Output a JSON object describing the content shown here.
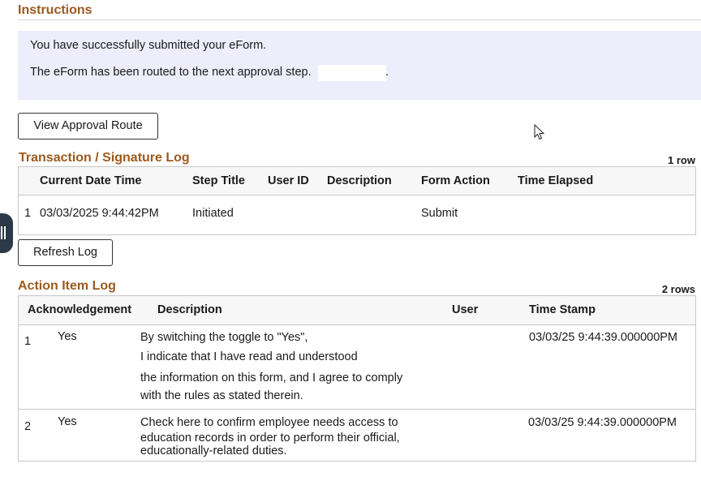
{
  "instructions": {
    "title": "Instructions",
    "line1": "You have successfully submitted your eForm.",
    "line2": "The eForm has been routed to the next approval step.",
    "line2_end": "."
  },
  "buttons": {
    "view_route": "View Approval Route",
    "refresh_log": "Refresh Log"
  },
  "transaction_log": {
    "title": "Transaction / Signature Log",
    "row_count": "1 row",
    "headers": [
      "Current Date Time",
      "Step Title",
      "User ID",
      "Description",
      "Form Action",
      "Time Elapsed"
    ],
    "rows": [
      {
        "num": "1",
        "datetime": "03/03/2025  9:44:42PM",
        "step": "Initiated",
        "user": "",
        "description": "",
        "action": "Submit",
        "elapsed": ""
      }
    ]
  },
  "action_log": {
    "title": "Action Item Log",
    "row_count": "2 rows",
    "headers": [
      "Acknowledgement",
      "Description",
      "User",
      "Time Stamp"
    ],
    "rows": [
      {
        "num": "1",
        "ack": "Yes",
        "desc": [
          "By switching the toggle to \"Yes\",",
          "I indicate that I have read and understood",
          "the information on this form, and I agree to comply",
          "with the rules as stated therein."
        ],
        "user": "",
        "timestamp": "03/03/25  9:44:39.000000PM"
      },
      {
        "num": "2",
        "ack": "Yes",
        "desc": [
          "Check here to confirm employee needs access to",
          "education records in order to perform their official,",
          "educationally-related duties."
        ],
        "user": "",
        "timestamp": "03/03/25  9:44:39.000000PM"
      }
    ]
  },
  "colors": {
    "section_title": "#9c5a1e",
    "message_bg": "#ededfc",
    "side_tab": "#2b3a48"
  },
  "icons": {
    "side_tab": "panel-toggle-icon",
    "cursor": "mouse-cursor-icon"
  }
}
